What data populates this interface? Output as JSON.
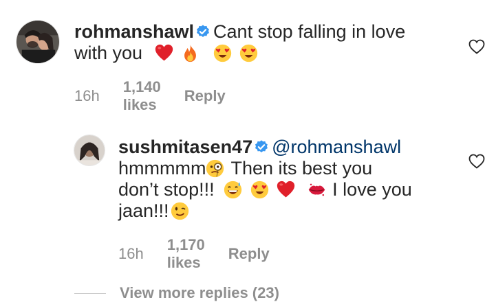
{
  "comments": [
    {
      "username": "rohmanshawl",
      "text_line1": "Cant stop falling in love",
      "text_line2": "with you",
      "time": "16h",
      "likes": "1,140 likes",
      "reply": "Reply",
      "emojis": [
        "red-heart",
        "fire",
        "heart-eyes",
        "heart-eyes"
      ]
    },
    {
      "username": "sushmitasen47",
      "mention": "@rohmanshawl",
      "text_a": "hmmmmm",
      "text_b": "Then its best you",
      "text_c": "don’t stop!!!",
      "text_d": "I love you",
      "text_e": "jaan!!!",
      "time": "16h",
      "likes": "1,170 likes",
      "reply": "Reply",
      "emojis": [
        "face-with-monocle",
        "grinning-sweat",
        "heart-eyes",
        "red-heart",
        "kiss-mark",
        "winking-face"
      ]
    }
  ],
  "view_more": "View more replies (23)",
  "colors": {
    "text": "#262626",
    "meta": "#8e8e8e",
    "mention": "#003569",
    "verified": "#3897f0"
  }
}
